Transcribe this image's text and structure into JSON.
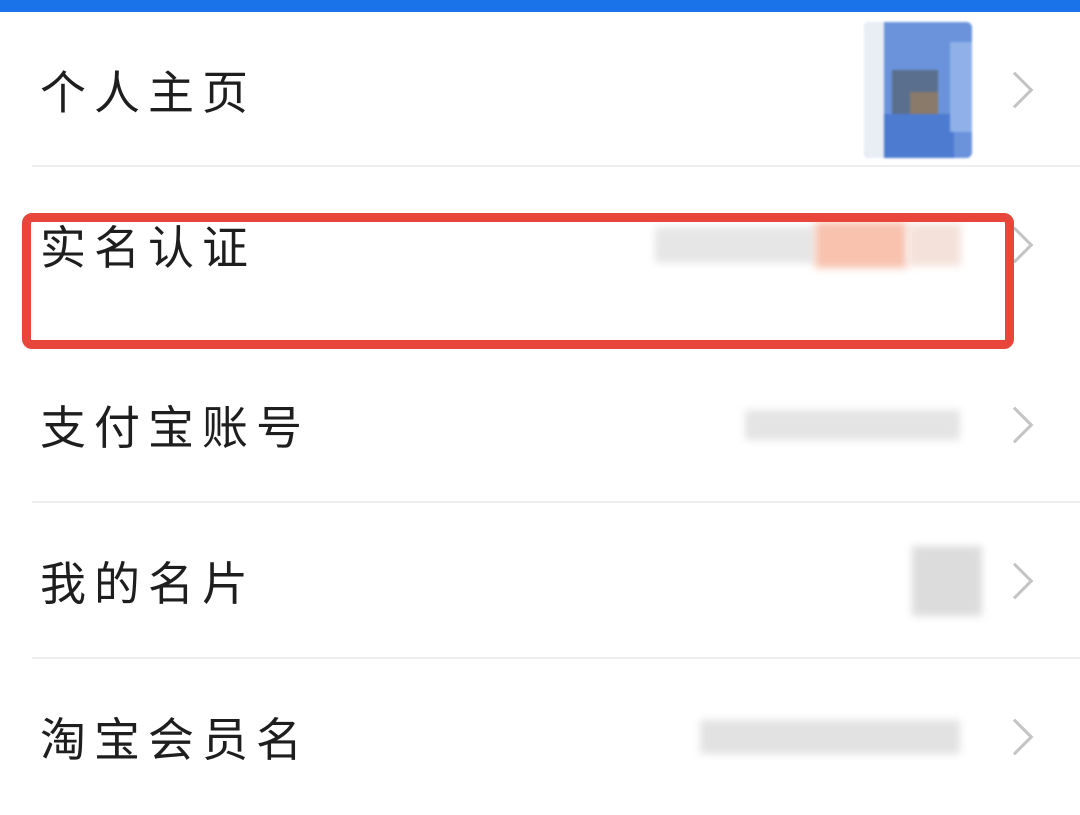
{
  "settings_list": {
    "items": [
      {
        "label": "个人主页",
        "value_type": "avatar"
      },
      {
        "label": "实名认证",
        "value_type": "masked-text",
        "highlighted": true
      },
      {
        "label": "支付宝账号",
        "value_type": "masked-text"
      },
      {
        "label": "我的名片",
        "value_type": "masked-qr"
      },
      {
        "label": "淘宝会员名",
        "value_type": "masked-text"
      }
    ]
  },
  "icons": {
    "row_arrow": "chevron-right-icon"
  },
  "colors": {
    "top_bar": "#1a73e8",
    "highlight_border": "#e8463a",
    "text": "#1e1e1e",
    "chevron": "#c4c4c4",
    "divider": "#eeeeee"
  }
}
